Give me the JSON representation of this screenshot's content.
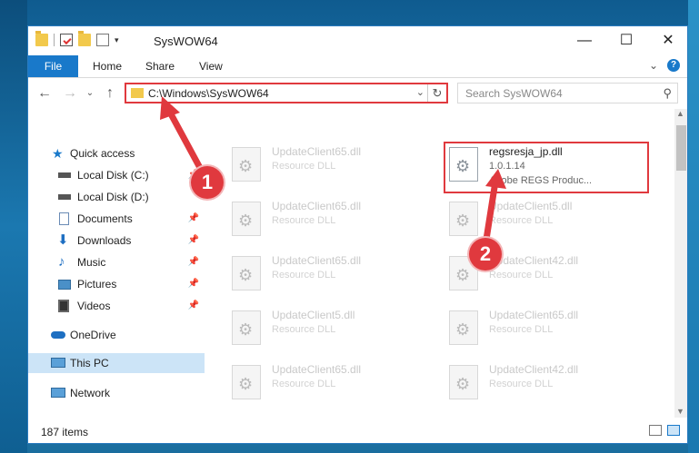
{
  "window": {
    "title": "SysWOW64",
    "controls": {
      "minimize": "—",
      "maximize": "☐",
      "close": "✕"
    }
  },
  "ribbon": {
    "file": "File",
    "tabs": [
      "Home",
      "Share",
      "View"
    ],
    "help": "?",
    "expand": "⌄"
  },
  "address": {
    "path": "C:\\Windows\\SysWOW64",
    "dropdown": "⌄",
    "refresh": "↻"
  },
  "search": {
    "placeholder": "Search SysWOW64",
    "icon": "⚲"
  },
  "nav": {
    "quick_access": "Quick access",
    "items": [
      {
        "label": "Local Disk (C:)",
        "icon": "drive-icon",
        "pinned": true
      },
      {
        "label": "Local Disk (D:)",
        "icon": "drive-icon",
        "pinned": false
      },
      {
        "label": "Documents",
        "icon": "documents-icon",
        "pinned": true
      },
      {
        "label": "Downloads",
        "icon": "downloads-icon",
        "pinned": true
      },
      {
        "label": "Music",
        "icon": "music-icon",
        "pinned": true
      },
      {
        "label": "Pictures",
        "icon": "pictures-icon",
        "pinned": true
      },
      {
        "label": "Videos",
        "icon": "videos-icon",
        "pinned": true
      }
    ],
    "onedrive": "OneDrive",
    "this_pc": "This PC",
    "network": "Network"
  },
  "files": {
    "left_column": [
      {
        "name": "UpdateClient65.dll",
        "type": "Resource DLL"
      },
      {
        "name": "UpdateClient65.dll",
        "type": "Resource DLL"
      },
      {
        "name": "UpdateClient65.dll",
        "type": "Resource DLL"
      },
      {
        "name": "UpdateClient5.dll",
        "type": "Resource DLL"
      },
      {
        "name": "UpdateClient65.dll",
        "type": "Resource DLL"
      }
    ],
    "right_column": [
      {
        "name": "regsresja_jp.dll",
        "type": "1.0.1.14",
        "extra": "Adobe REGS    Produc..."
      },
      {
        "name": "UpdateClient5.dll",
        "type": "Resource DLL"
      },
      {
        "name": "UpdateClient42.dll",
        "type": "Resource DLL"
      },
      {
        "name": "UpdateClient65.dll",
        "type": "Resource DLL"
      },
      {
        "name": "UpdateClient42.dll",
        "type": "Resource DLL"
      }
    ]
  },
  "status": {
    "count": "187 items"
  },
  "callouts": [
    "1",
    "2"
  ],
  "colors": {
    "accent": "#1979ca",
    "highlight": "#e0393e"
  }
}
